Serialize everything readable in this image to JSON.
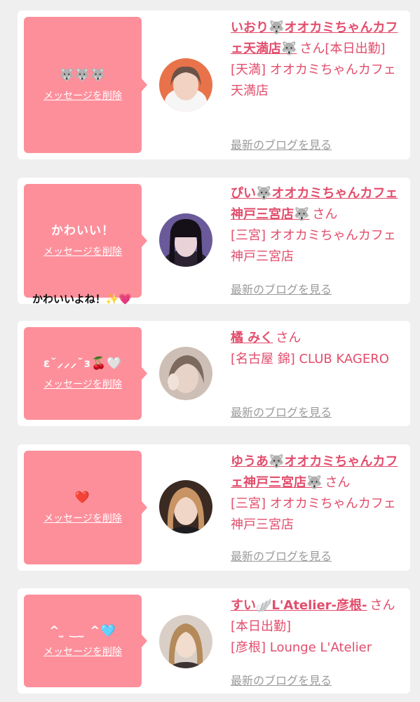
{
  "cards": [
    {
      "message": "🐺🐺🐺",
      "delete_label": "メッセージを削除",
      "name": "いおり🐺オオカミちゃんカフェ天満店🐺",
      "suffix": "さん[本日出勤]",
      "shop": "[天満] オオカミちゃんカフェ天満店",
      "blog_label": "最新のブログを見る"
    },
    {
      "message": "かわいい！",
      "delete_label": "メッセージを削除",
      "overflow_message": "かわいいよね！✨💗",
      "name": "ぴい🐺オオカミちゃんカフェ神戸三宮店🐺",
      "suffix": "さん",
      "shop": "[三宮] オオカミちゃんカフェ神戸三宮店",
      "blog_label": "最新のブログを見る"
    },
    {
      "message": "ɛ˘⸝⸝⸝˘ɜ🍒🤍",
      "delete_label": "メッセージを削除",
      "name": "橘 みく",
      "suffix": "さん",
      "shop": "[名古屋 錦] CLUB KAGERO",
      "blog_label": "最新のブログを見る"
    },
    {
      "message": "❤️",
      "delete_label": "メッセージを削除",
      "name": "ゆうあ🐺オオカミちゃんカフェ神戸三宮店🐺",
      "suffix": "さん",
      "shop": "[三宮] オオカミちゃんカフェ神戸三宮店",
      "blog_label": "最新のブログを見る"
    },
    {
      "message": "^ ̫ ‿ ̫ ^🩵",
      "delete_label": "メッセージを削除",
      "name": "すい🪽L'Atelier-彦根-",
      "suffix": "さん[本日出勤]",
      "shop": "[彦根] Lounge L'Atelier",
      "blog_label": "最新のブログを見る"
    }
  ],
  "colors": {
    "accent": "#e24d6c",
    "message_box": "#fd8f9b",
    "background": "#f0efef",
    "muted_link": "#9b9b9b"
  }
}
